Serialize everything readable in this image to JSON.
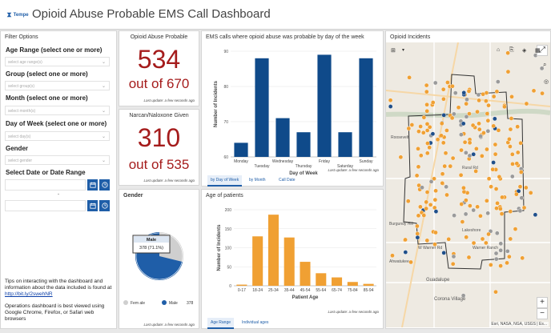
{
  "header": {
    "logo_text": "Tempe",
    "title": "Opioid Abuse Probable EMS Call Dashboard"
  },
  "filters": {
    "panel_title": "Filter Options",
    "age_label": "Age Range (select one or more)",
    "age_placeholder": "select age range(s)",
    "group_label": "Group (select one or more)",
    "group_placeholder": "select group(s)",
    "month_label": "Month (select one or more)",
    "month_placeholder": "select month(s)",
    "dow_label": "Day of Week (select one or more)",
    "dow_placeholder": "select day(s)",
    "gender_label": "Gender",
    "gender_placeholder": "select gender",
    "date_label": "Select Date or Date Range",
    "date_separator": "-"
  },
  "tips": {
    "text": "Tips on interacting with the dashboard and information about the data included is found at ",
    "link": "http://bit.ly/2swehNR",
    "note": "Operations dashboard is best viewed using Google Chrome, Firefox, or Safari web browsers"
  },
  "opioid": {
    "title": "Opioid Abuse Probable",
    "value": "534",
    "sub": "out of 670",
    "updated": "Last update: a few seconds ago"
  },
  "narcan": {
    "title": "Narcan/Naloxone Given",
    "value": "310",
    "sub": "out of 535",
    "updated": "Last update: a few seconds ago"
  },
  "gender": {
    "title": "Gender",
    "tooltip_label": "Male",
    "tooltip_value": "378 (71.1%)",
    "legend": [
      {
        "label": "Fem ale",
        "value": "",
        "color": "#cfcfcf"
      },
      {
        "label": "Male",
        "value": "378",
        "color": "#1f5ea8"
      }
    ],
    "updated": "Last update: a few seconds ago"
  },
  "dow_chart": {
    "title": "EMS calls where opioid abuse was probable by day of the week",
    "updated": "Last update: a few seconds ago",
    "tabs": [
      "by Day of Week",
      "by Month",
      "Call Date"
    ]
  },
  "age_chart": {
    "title": "Age of patients",
    "updated": "Last update: a few seconds ago",
    "tabs": [
      "Age Range",
      "Individual ages"
    ]
  },
  "map": {
    "title": "Opioid Incidents",
    "attribution": "Esri, NASA, NGA, USGS | Es...",
    "zoom_in": "+",
    "zoom_out": "−",
    "labels": {
      "l1": "Guadalupe",
      "l2": "Corona Village",
      "l3": "Burgundy Hill",
      "l4": "Lakeshore",
      "l5": "Warner Ranch",
      "l6": "W Warner Rd",
      "l7": "Roosevelt",
      "l8": "Rural Rd",
      "l9": "Ahwatukee"
    }
  },
  "colors": {
    "accent": "#1f5ea8",
    "bar_blue": "#0f4a8a",
    "bar_orange": "#f0a033",
    "big_red": "#a51c1c"
  },
  "chart_data": [
    {
      "type": "bar",
      "title": "EMS calls where opioid abuse was probable by day of the week",
      "categories": [
        "Monday",
        "Tuesday",
        "Wednesday",
        "Thursday",
        "Friday",
        "Saturday",
        "Sunday"
      ],
      "values": [
        64,
        88,
        71,
        67,
        89,
        67,
        88
      ],
      "xlabel": "Day of Week",
      "ylabel": "Number of Incidents",
      "ylim": [
        60,
        90
      ],
      "yticks": [
        60,
        70,
        80,
        90
      ]
    },
    {
      "type": "bar",
      "title": "Age of patients",
      "categories": [
        "0-17",
        "18-24",
        "25-34",
        "35-44",
        "45-54",
        "55-64",
        "65-74",
        "75-84",
        "85-94"
      ],
      "values": [
        3,
        130,
        187,
        127,
        63,
        33,
        22,
        10,
        5
      ],
      "xlabel": "Patient Age",
      "ylabel": "Number of Incidents",
      "ylim": [
        0,
        200
      ],
      "yticks": [
        0,
        50,
        100,
        150,
        200
      ]
    },
    {
      "type": "pie",
      "title": "Gender",
      "categories": [
        "Female",
        "Male"
      ],
      "values": [
        153,
        378
      ]
    }
  ]
}
